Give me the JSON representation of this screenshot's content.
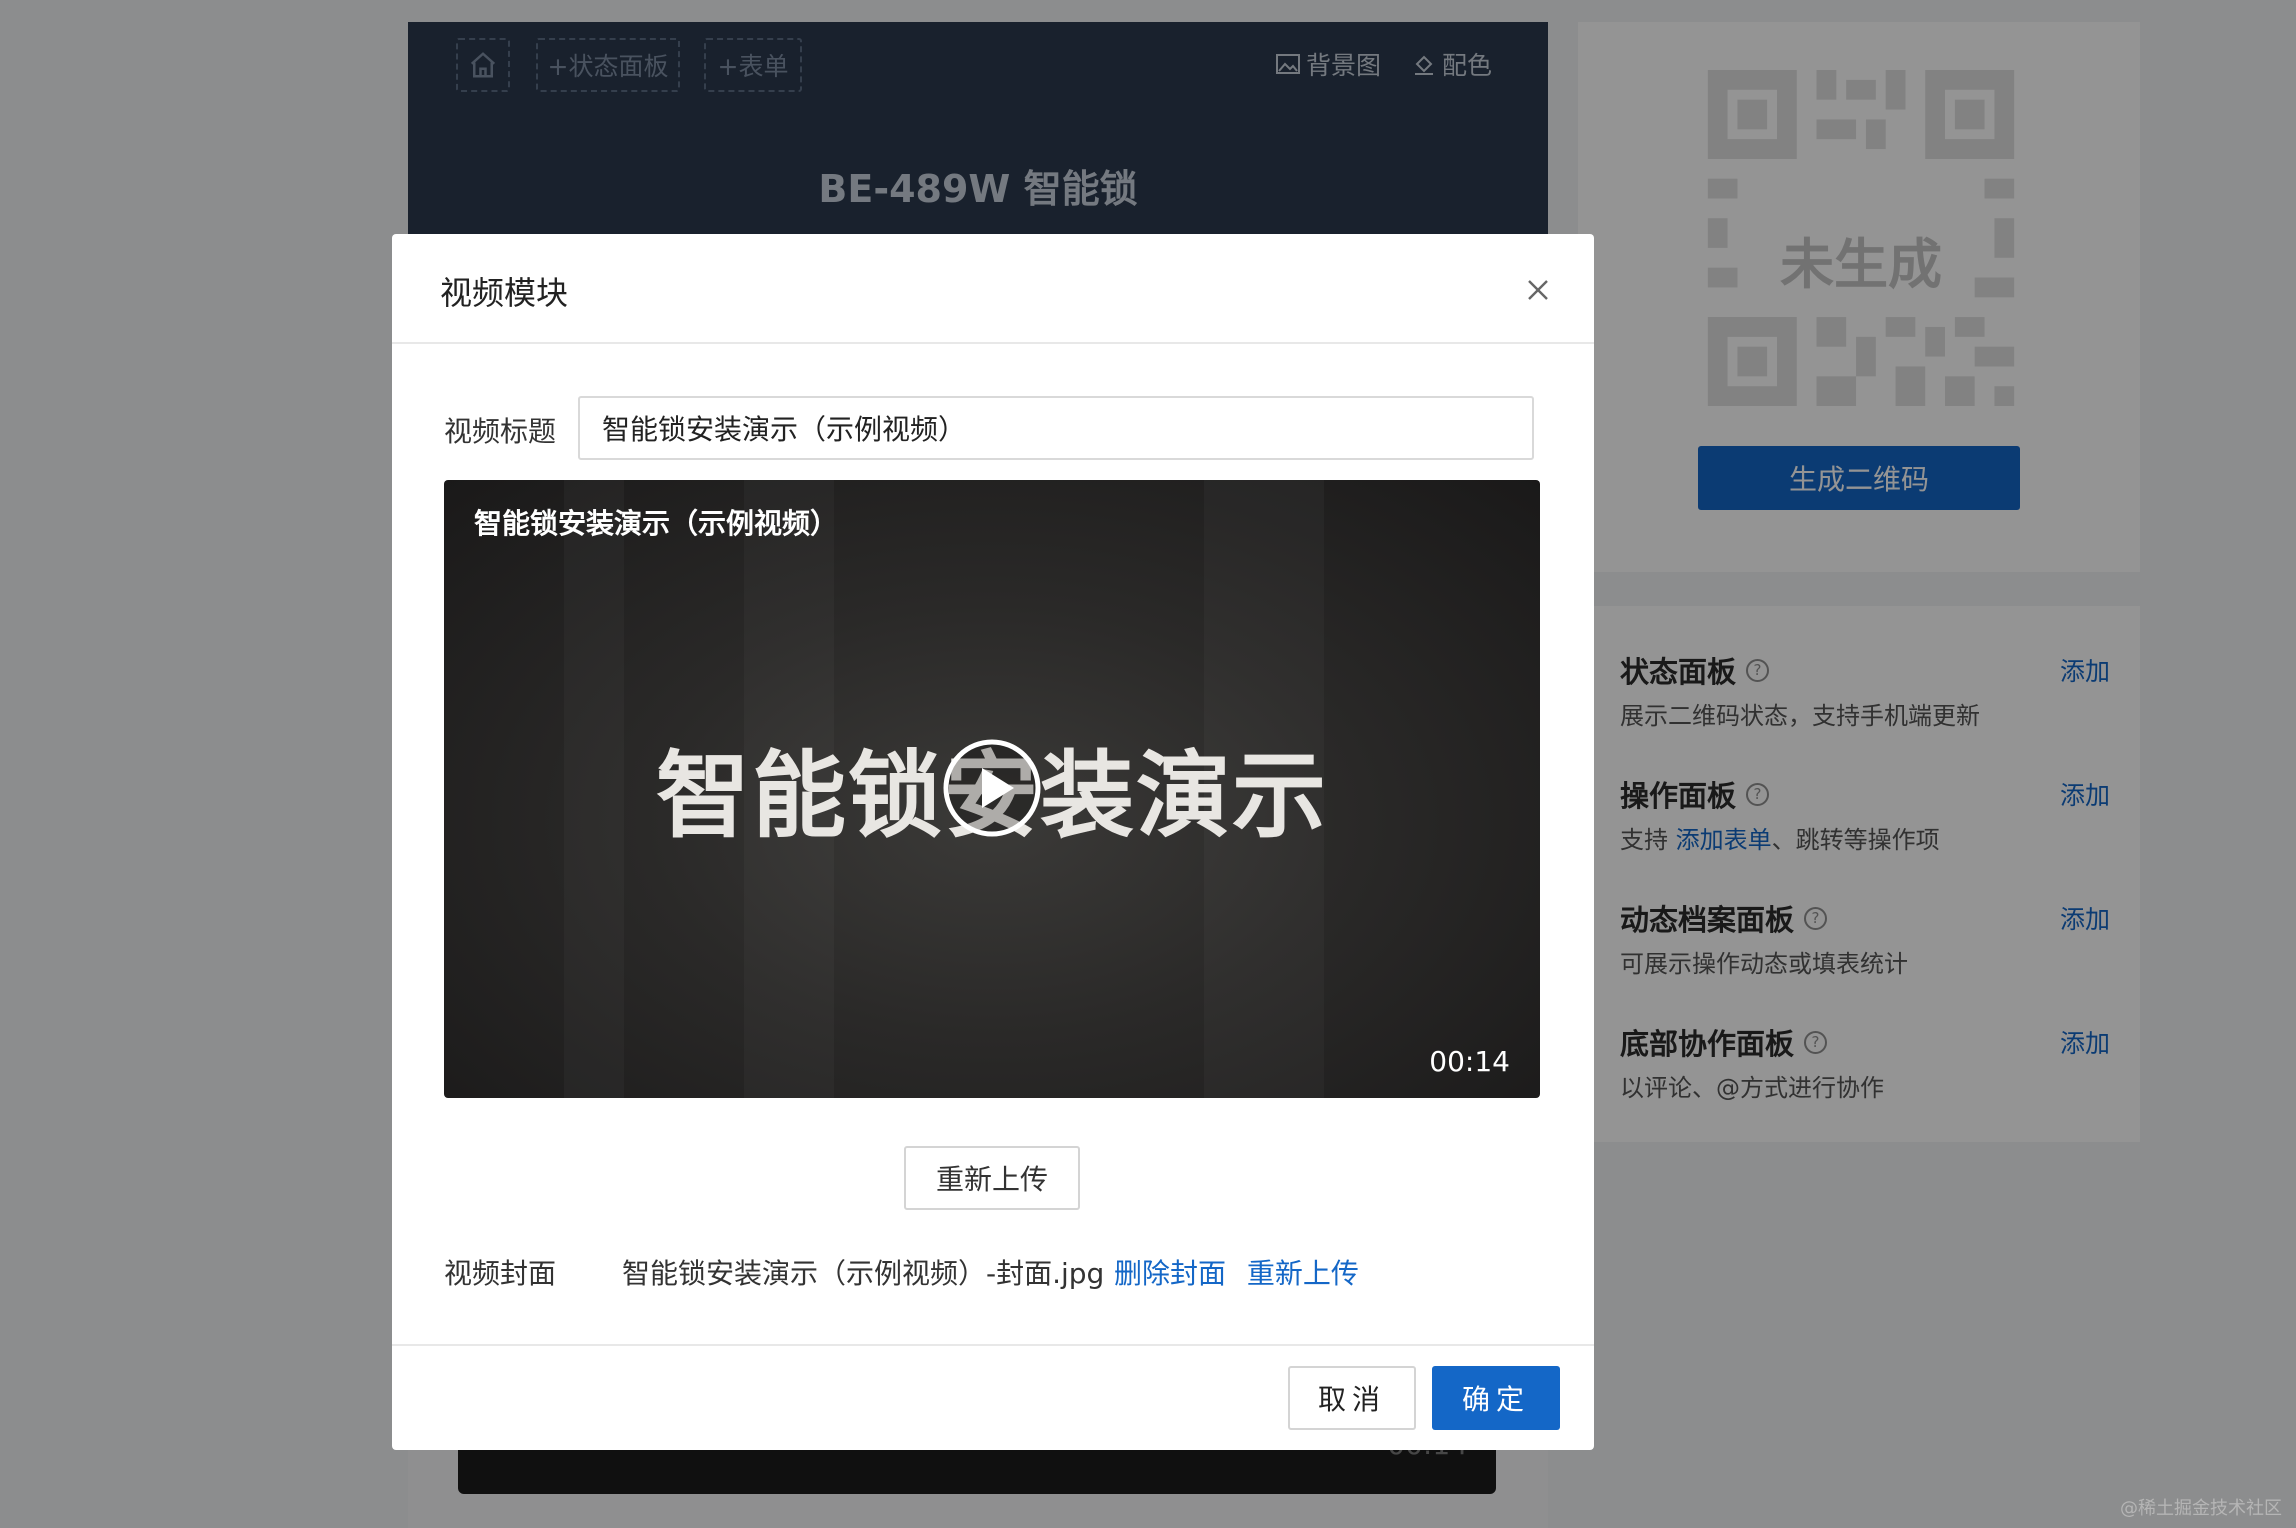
{
  "editor": {
    "toolbar": {
      "home_icon": "home-icon",
      "add_status_panel": "+状态面板",
      "add_form": "+表单",
      "background_image": "背景图",
      "color_scheme": "配色"
    },
    "page_title": "BE-489W 智能锁",
    "bottom_video_time": "00:14"
  },
  "qr": {
    "placeholder_label": "未生成",
    "generate_button": "生成二维码"
  },
  "panels": [
    {
      "title": "状态面板",
      "desc": "展示二维码状态，支持手机端更新",
      "add": "添加"
    },
    {
      "title": "操作面板",
      "desc_prefix": "支持 ",
      "desc_link": "添加表单",
      "desc_suffix": "、跳转等操作项",
      "add": "添加"
    },
    {
      "title": "动态档案面板",
      "desc": "可展示操作动态或填表统计",
      "add": "添加"
    },
    {
      "title": "底部协作面板",
      "desc": "以评论、@方式进行协作",
      "add": "添加"
    }
  ],
  "modal": {
    "title": "视频模块",
    "video_title_label": "视频标题",
    "video_title_value": "智能锁安装演示（示例视频）",
    "video": {
      "overlay_title": "智能锁安装演示（示例视频）",
      "caption": "智能锁安装演示",
      "duration": "00:14"
    },
    "reupload_button": "重新上传",
    "cover": {
      "label": "视频封面",
      "filename": "智能锁安装演示（示例视频）-封面.jpg",
      "delete_link": "删除封面",
      "reupload_link": "重新上传"
    },
    "cancel_button": "取消",
    "ok_button": "确定"
  },
  "watermark": "@稀土掘金技术社区",
  "colors": {
    "primary": "#1467c7",
    "header_bg": "#2c3a4e"
  }
}
